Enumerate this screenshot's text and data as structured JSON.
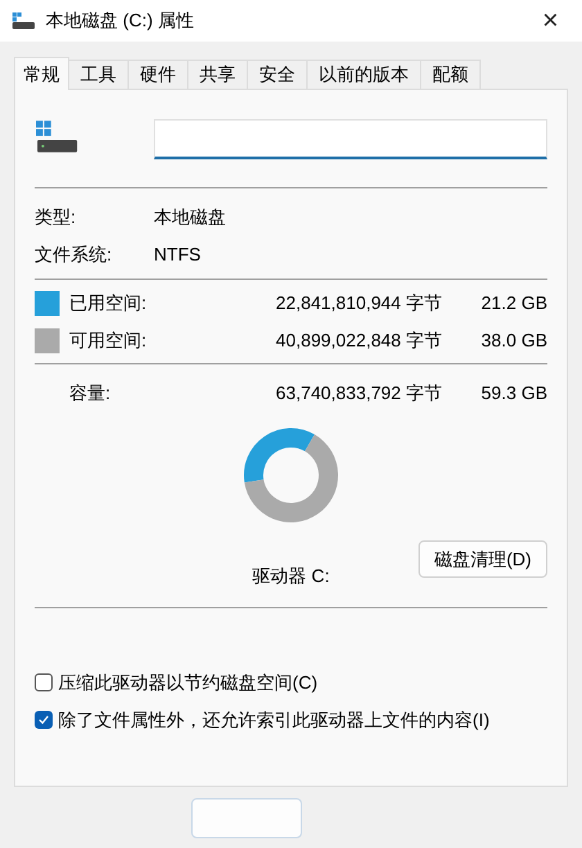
{
  "window": {
    "title": "本地磁盘 (C:) 属性",
    "close": "×"
  },
  "tabs": [
    {
      "label": "常规",
      "selected": true
    },
    {
      "label": "工具",
      "selected": false
    },
    {
      "label": "硬件",
      "selected": false
    },
    {
      "label": "共享",
      "selected": false
    },
    {
      "label": "安全",
      "selected": false
    },
    {
      "label": "以前的版本",
      "selected": false
    },
    {
      "label": "配额",
      "selected": false
    }
  ],
  "info": [
    {
      "label": "类型:",
      "value": "本地磁盘"
    },
    {
      "label": "文件系统:",
      "value": "NTFS"
    }
  ],
  "space": [
    {
      "label": "已用空间:",
      "bytes": "22,841,810,944 字节",
      "size": "21.2 GB",
      "color": "#26a0da"
    },
    {
      "label": "可用空间:",
      "bytes": "40,899,022,848 字节",
      "size": "38.0 GB",
      "color": "#aaaaaa"
    }
  ],
  "capacity": {
    "label": "容量:",
    "bytes": "63,740,833,792 字节",
    "size": "59.3 GB"
  },
  "usage": {
    "chart_data": {
      "type": "donut",
      "values": [
        35.8,
        64.2
      ]
    }
  },
  "drive_label": "驱动器 C:",
  "cleanup_button": "磁盘清理(D)",
  "options": [
    {
      "label": "压缩此驱动器以节约磁盘空间(C)",
      "checked": false
    },
    {
      "label": "除了文件属性外，还允许索引此驱动器上文件的内容(I)",
      "checked": true
    }
  ]
}
